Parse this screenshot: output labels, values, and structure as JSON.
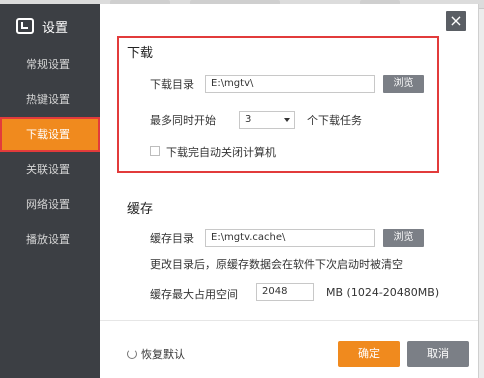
{
  "title": "设置",
  "sidebar": {
    "items": [
      {
        "label": "常规设置"
      },
      {
        "label": "热键设置"
      },
      {
        "label": "下载设置"
      },
      {
        "label": "关联设置"
      },
      {
        "label": "网络设置"
      },
      {
        "label": "播放设置"
      }
    ],
    "active_index": 2
  },
  "close_label": "×",
  "download": {
    "section_title": "下载",
    "dir_label": "下载目录",
    "dir_value": "E:\\mgtv\\",
    "browse_label": "浏览",
    "max_label": "最多同时开始",
    "max_value": "3",
    "max_suffix": "个下载任务",
    "auto_shutdown_label": "下载完自动关闭计算机",
    "auto_shutdown_checked": false
  },
  "cache": {
    "section_title": "缓存",
    "dir_label": "缓存目录",
    "dir_value": "E:\\mgtv.cache\\",
    "browse_label": "浏览",
    "note": "更改目录后，原缓存数据会在软件下次启动时被清空",
    "max_label": "缓存最大占用空间",
    "max_value": "2048",
    "max_unit": "MB (1024-20480MB)"
  },
  "footer": {
    "restore_label": "恢复默认",
    "ok_label": "确定",
    "cancel_label": "取消"
  },
  "colors": {
    "accent": "#f08a1e",
    "sidebar_bg": "#3c3f44",
    "highlight_border": "#e23b3b",
    "gray_button": "#7b7f86"
  }
}
